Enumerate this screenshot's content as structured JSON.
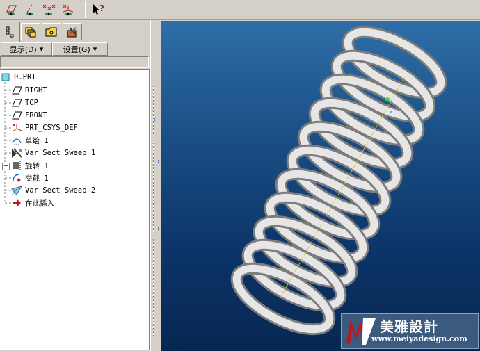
{
  "toolbar": {
    "buttons": [
      "datum-plane-display-icon",
      "datum-axis-display-icon",
      "datum-point-display-icon",
      "csys-display-icon",
      "whats-this-help-icon"
    ],
    "help_label": "?"
  },
  "navigator": {
    "tabs": [
      "model-tree-tab",
      "layers-tab",
      "folder-browser-tab",
      "favorites-tab"
    ],
    "menu": {
      "show_label": "显示(D)",
      "settings_label": "设置(G)"
    }
  },
  "model_tree": {
    "items": [
      {
        "label": "0.PRT",
        "icon": "part-icon"
      },
      {
        "label": "RIGHT",
        "icon": "datum-plane-icon"
      },
      {
        "label": "TOP",
        "icon": "datum-plane-icon"
      },
      {
        "label": "FRONT",
        "icon": "datum-plane-icon"
      },
      {
        "label": "PRT_CSYS_DEF",
        "icon": "csys-icon"
      },
      {
        "label": "草绘 1",
        "icon": "sketch-icon"
      },
      {
        "label": "Var Sect Sweep 1",
        "icon": "var-sect-sweep-icon"
      },
      {
        "label": "旋转 1",
        "icon": "revolve-icon"
      },
      {
        "label": "交截 1",
        "icon": "intersect-icon"
      },
      {
        "label": "Var Sect Sweep 2",
        "icon": "var-sect-sweep-icon"
      },
      {
        "label": "在此插入",
        "icon": "insert-here-arrow-icon"
      }
    ]
  },
  "watermark": {
    "name": "美雅設計",
    "url": "www.meiyadesign.com"
  },
  "colors": {
    "viewport_top": "#2f6ea8",
    "viewport_bottom": "#072752",
    "spring": "#e8e8e8",
    "panel": "#d4d0c8"
  }
}
